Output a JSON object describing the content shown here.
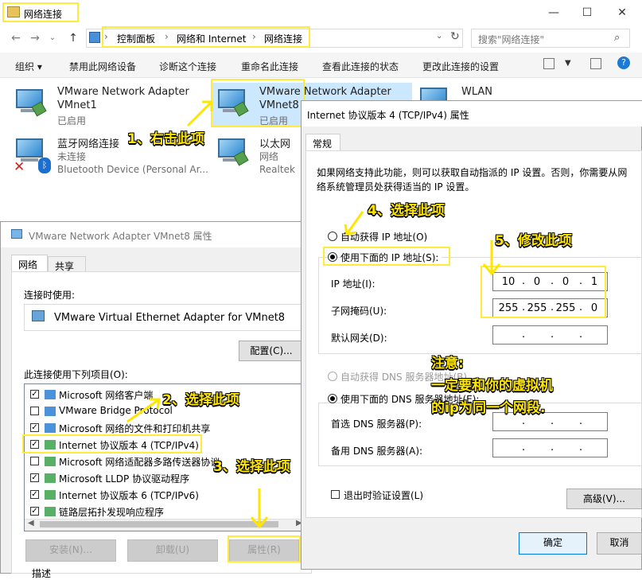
{
  "explorer": {
    "title": "网络连接",
    "breadcrumb": [
      "控制面板",
      "网络和 Internet",
      "网络连接"
    ],
    "search_placeholder": "搜索\"网络连接\"",
    "toolbar": [
      "组织 ▾",
      "禁用此网络设备",
      "诊断这个连接",
      "重命名此连接",
      "查看此连接的状态",
      "更改此连接的设置"
    ],
    "adapters": [
      {
        "name": "VMware Network Adapter",
        "name2": "VMnet1",
        "status": "已启用"
      },
      {
        "name": "VMware Network Adapter",
        "name2": "VMnet8",
        "status": "已启用"
      },
      {
        "name": "WLAN",
        "name2": "",
        "status": ""
      },
      {
        "name": "蓝牙网络连接",
        "name2": "未连接",
        "status": "Bluetooth Device (Personal Ar..."
      },
      {
        "name": "以太网",
        "name2": "网络",
        "status": "Realtek"
      }
    ]
  },
  "props": {
    "title": "VMware Network Adapter VMnet8 属性",
    "tabs": [
      "网络",
      "共享"
    ],
    "connect_using_label": "连接时使用:",
    "adapter_name": "VMware Virtual Ethernet Adapter for VMnet8",
    "configure_button": "配置(C)...",
    "items_label": "此连接使用下列项目(O):",
    "items": [
      {
        "label": "Microsoft 网络客户端",
        "checked": true
      },
      {
        "label": "VMware Bridge Protocol",
        "checked": false
      },
      {
        "label": "Microsoft 网络的文件和打印机共享",
        "checked": true
      },
      {
        "label": "Internet 协议版本 4 (TCP/IPv4)",
        "checked": true
      },
      {
        "label": "Microsoft 网络适配器多路传送器协议",
        "checked": false
      },
      {
        "label": "Microsoft LLDP 协议驱动程序",
        "checked": true
      },
      {
        "label": "Internet 协议版本 6 (TCP/IPv6)",
        "checked": true
      },
      {
        "label": "链路层拓扑发现响应程序",
        "checked": true
      }
    ],
    "install_button": "安装(N)...",
    "uninstall_button": "卸载(U)",
    "properties_button": "属性(R)",
    "desc_label": "描述"
  },
  "ipv4": {
    "title": "Internet 协议版本 4 (TCP/IPv4) 属性",
    "tab": "常规",
    "intro": "如果网络支持此功能，则可以获取自动指派的 IP 设置。否则，你需要从网络系统管理员处获得适当的 IP 设置。",
    "auto_ip": "自动获得 IP 地址(O)",
    "use_ip": "使用下面的 IP 地址(S):",
    "ip_label": "IP 地址(I):",
    "mask_label": "子网掩码(U):",
    "gateway_label": "默认网关(D):",
    "ip": [
      "10",
      "0",
      "0",
      "1"
    ],
    "mask": [
      "255",
      "255",
      "255",
      "0"
    ],
    "auto_dns": "自动获得 DNS 服务器地址(B)",
    "use_dns": "使用下面的 DNS 服务器地址(E):",
    "dns1_label": "首选 DNS 服务器(P):",
    "dns2_label": "备用 DNS 服务器(A):",
    "validate_label": "退出时验证设置(L)",
    "advanced_button": "高级(V)...",
    "ok_button": "确定",
    "cancel_button": "取消"
  },
  "annotations": {
    "step1": "1、右击此项",
    "step2": "2、选择此项",
    "step3": "3、选择此项",
    "step4": "4、选择此项",
    "step5": "5、修改此项",
    "note1": "注意:",
    "note2": "一定要和你的虚拟机",
    "note3": "的ip为同一个网段."
  },
  "colors": {
    "highlight": "#ffeb3b",
    "selection": "#cce8ff",
    "accent": "#0078d7"
  }
}
